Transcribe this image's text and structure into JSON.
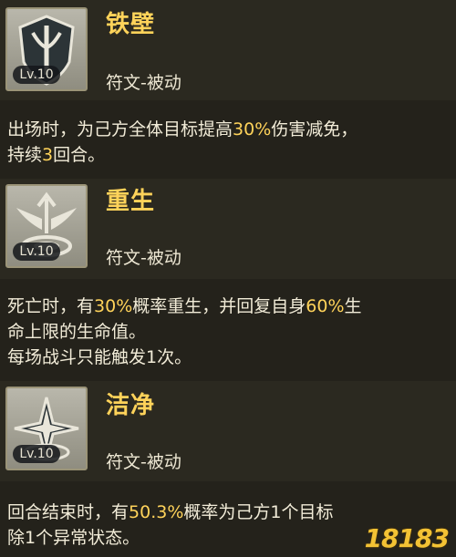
{
  "skills": [
    {
      "name": "铁壁",
      "level": "Lv.10",
      "type": "符文-被动",
      "icon": "shield-icon",
      "desc_lines": [
        {
          "a": "出场时，为己方全体目标提高",
          "b": "30%",
          "c": "伤害减免，"
        },
        {
          "a": "持续",
          "b": "3",
          "c": "回合。"
        }
      ]
    },
    {
      "name": "重生",
      "level": "Lv.10",
      "type": "符文-被动",
      "icon": "wings-rebirth-icon",
      "desc_lines": [
        {
          "a": "死亡时，有",
          "b": "30%",
          "c": "概率重生，并回复自身",
          "d": "60%",
          "e": "生"
        },
        {
          "a": "命上限的生命值。"
        },
        {
          "a": "每场战斗只能触发1次。"
        }
      ]
    },
    {
      "name": "洁净",
      "level": "Lv.10",
      "type": "符文-被动",
      "icon": "sparkle-purify-icon",
      "desc_lines": [
        {
          "a": "回合结束时，有",
          "b": "50.3%",
          "c": "概率为己方1个目标"
        },
        {
          "a": "除1个异常状态。"
        }
      ]
    }
  ],
  "watermark": "18183",
  "colors": {
    "highlight": "#ffd35a",
    "background": "#24221b",
    "text": "#f2ecd8"
  }
}
